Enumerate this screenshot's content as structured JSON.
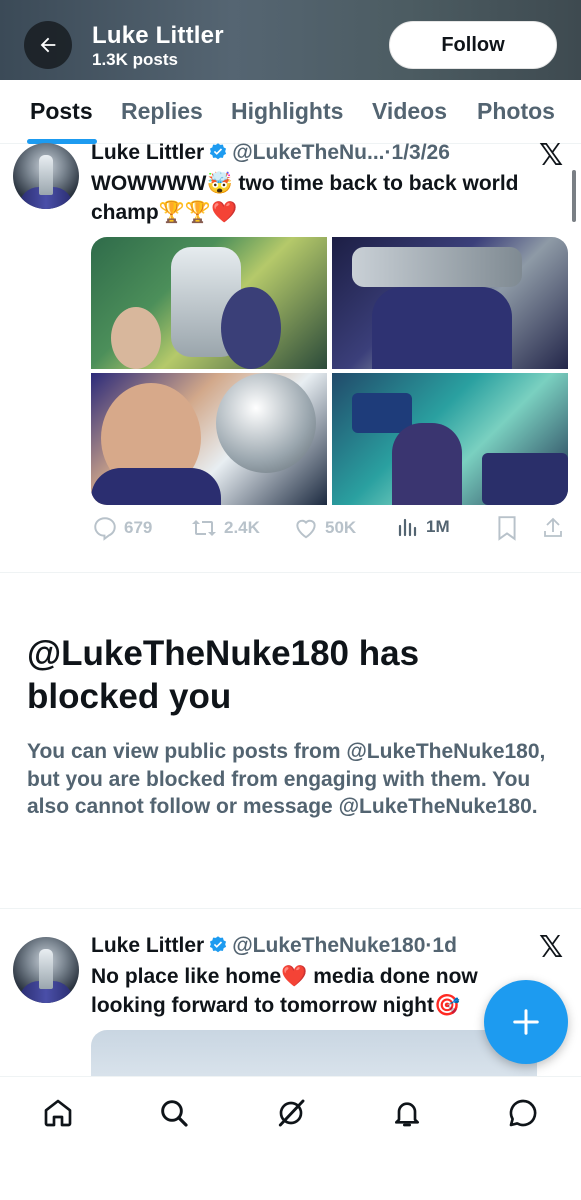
{
  "header": {
    "name": "Luke Littler",
    "post_count": "1.3K posts",
    "follow_label": "Follow"
  },
  "tabs": [
    {
      "label": "Posts",
      "active": true
    },
    {
      "label": "Replies"
    },
    {
      "label": "Highlights"
    },
    {
      "label": "Videos"
    },
    {
      "label": "Photos"
    }
  ],
  "post1": {
    "name": "Luke Littler",
    "handle": "@LukeTheNu...",
    "separator": "·",
    "date": "1/3/26",
    "text_line1": "WOWWWW🤯 two time back to back world",
    "text_line2": "champ🏆🏆❤️",
    "replies": "679",
    "reposts": "2.4K",
    "likes": "50K",
    "views": "1M"
  },
  "blocked": {
    "title": "@LukeTheNuke180 has blocked you",
    "body": "You can view public posts from @LukeTheNuke180, but you are blocked from engaging with them. You also cannot follow or message @LukeTheNuke180."
  },
  "post2": {
    "name": "Luke Littler",
    "handle": "@LukeTheNuke180",
    "separator": "·",
    "date": "1d",
    "text_line1": "No place like home❤️ media done now",
    "text_line2": "looking forward to tomorrow night🎯"
  },
  "colors": {
    "accent": "#1d9bf0",
    "text_primary": "#0f1419",
    "text_secondary": "#536471"
  },
  "icons": {
    "back": "back-arrow-icon",
    "verified": "verified-badge-icon",
    "x": "x-logo-icon",
    "reply": "reply-icon",
    "repost": "repost-icon",
    "like": "heart-icon",
    "views": "views-chart-icon",
    "bookmark": "bookmark-icon",
    "share": "share-icon",
    "compose": "plus-icon",
    "nav": [
      "home-icon",
      "search-icon",
      "grok-icon",
      "notifications-icon",
      "messages-icon"
    ]
  }
}
